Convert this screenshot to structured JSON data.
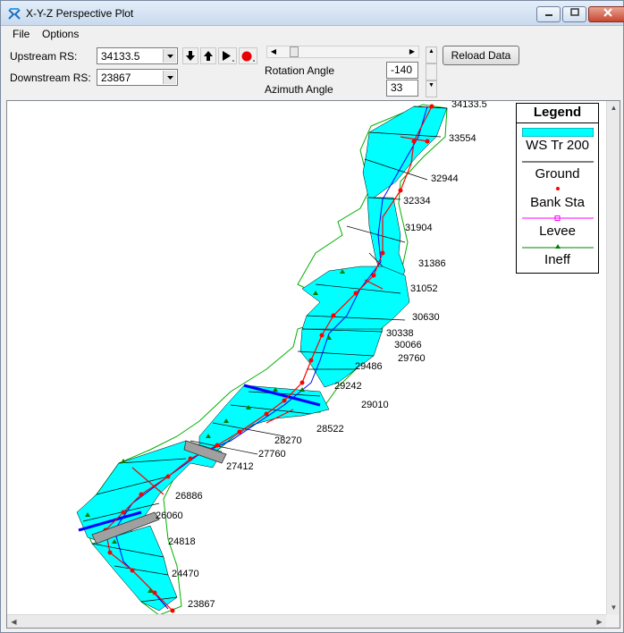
{
  "window": {
    "title": "X-Y-Z Perspective Plot",
    "controls": [
      "minimize",
      "maximize",
      "close"
    ]
  },
  "menu": {
    "items": [
      "File",
      "Options"
    ]
  },
  "toolbar": {
    "upstream_label": "Upstream RS:",
    "upstream_value": "34133.5",
    "downstream_label": "Downstream RS:",
    "downstream_value": "23867",
    "rotation_label": "Rotation Angle",
    "rotation_value": "-140",
    "azimuth_label": "Azimuth Angle",
    "azimuth_value": "33",
    "reload_label": "Reload Data",
    "buttons": [
      "arrow-down-icon",
      "arrow-up-icon",
      "play-icon",
      "record-icon"
    ]
  },
  "legend": {
    "title": "Legend",
    "items": [
      {
        "label": "WS Tr 200",
        "color": "#00ffff"
      },
      {
        "label": "Ground",
        "color": "#000000"
      },
      {
        "label": "Bank Sta",
        "color": "#ff0000"
      },
      {
        "label": "Levee",
        "color": "#ff00ff"
      },
      {
        "label": "Ineff",
        "color": "#008000"
      }
    ]
  },
  "river_stations": [
    "34133.5",
    "33554",
    "32944",
    "32334",
    "31904",
    "31386",
    "31052",
    "30630",
    "30338",
    "30066",
    "29760",
    "29486",
    "29242",
    "29010",
    "28522",
    "28270",
    "27760",
    "27412",
    "26886",
    "26060",
    "24818",
    "24470",
    "23867"
  ],
  "colors": {
    "water": "#00ffff",
    "ground": "#000000",
    "bank": "#ff0000",
    "levee": "#ff00ff",
    "ineff": "#008000",
    "channel": "#0000ff"
  }
}
